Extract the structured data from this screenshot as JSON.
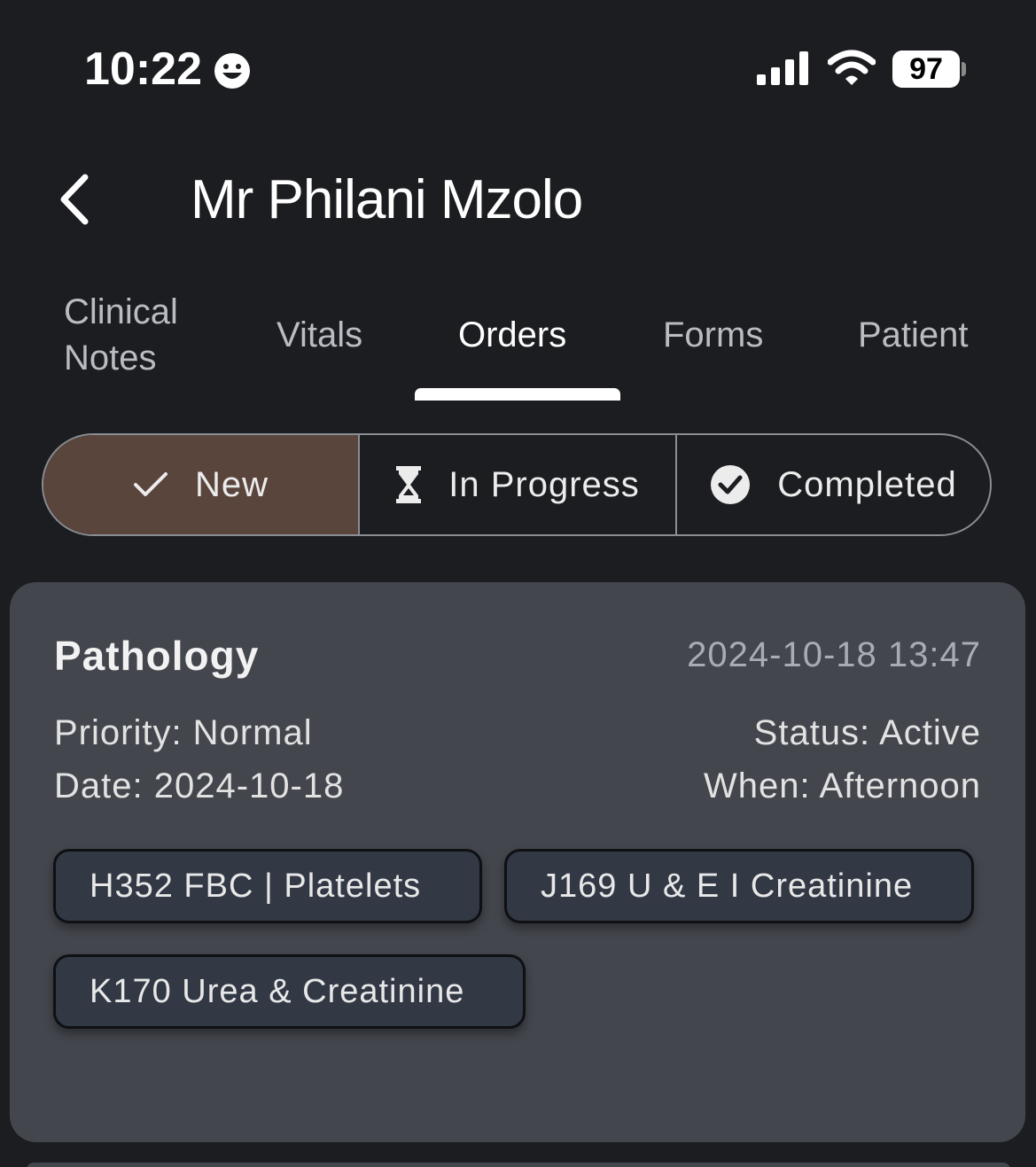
{
  "status_bar": {
    "time": "10:22",
    "battery": "97",
    "icons": [
      "smiley-face-icon",
      "signal-bars-icon",
      "wifi-icon",
      "battery-icon"
    ]
  },
  "header": {
    "back_icon": "chevron-left-icon",
    "title": "Mr Philani Mzolo"
  },
  "tabs": [
    {
      "label_line1": "Clinical",
      "label_line2": "Notes",
      "active": false
    },
    {
      "label": "Vitals",
      "active": false
    },
    {
      "label": "Orders",
      "active": true
    },
    {
      "label": "Forms",
      "active": false
    },
    {
      "label": "Patient",
      "active": false
    }
  ],
  "filter": {
    "options": [
      {
        "label": "New",
        "icon": "checkmark-icon",
        "selected": true
      },
      {
        "label": "In Progress",
        "icon": "hourglass-icon",
        "selected": false
      },
      {
        "label": "Completed",
        "icon": "check-circle-icon",
        "selected": false
      }
    ],
    "selected_color": "#5a453d"
  },
  "order_card": {
    "category": "Pathology",
    "datetime": "2024-10-18 13:47",
    "priority": "Priority: Normal",
    "date": "Date: 2024-10-18",
    "status": "Status: Active",
    "when": "When: Afternoon",
    "tests": [
      "H352 FBC | Platelets",
      "J169 U & E I Creatinine",
      "K170 Urea & Creatinine"
    ]
  },
  "colors": {
    "background": "#1c1d20",
    "card": "#43464d",
    "chip": "#323945"
  }
}
